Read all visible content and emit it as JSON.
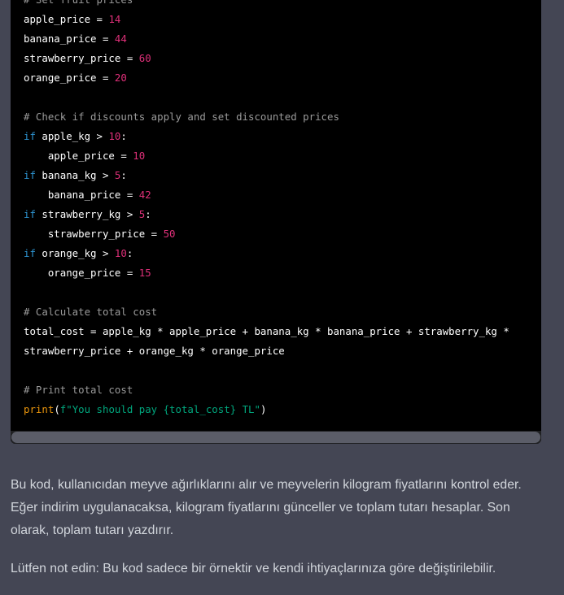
{
  "code": {
    "lines": [
      [
        {
          "t": "c",
          "v": "# Set fruit prices"
        }
      ],
      [
        {
          "t": "p",
          "v": "apple_price = "
        },
        {
          "t": "n",
          "v": "14"
        }
      ],
      [
        {
          "t": "p",
          "v": "banana_price = "
        },
        {
          "t": "n",
          "v": "44"
        }
      ],
      [
        {
          "t": "p",
          "v": "strawberry_price = "
        },
        {
          "t": "n",
          "v": "60"
        }
      ],
      [
        {
          "t": "p",
          "v": "orange_price = "
        },
        {
          "t": "n",
          "v": "20"
        }
      ],
      [],
      [
        {
          "t": "c",
          "v": "# Check if discounts apply and set discounted prices"
        }
      ],
      [
        {
          "t": "k",
          "v": "if"
        },
        {
          "t": "p",
          "v": " apple_kg > "
        },
        {
          "t": "n",
          "v": "10"
        },
        {
          "t": "p",
          "v": ":"
        }
      ],
      [
        {
          "t": "p",
          "v": "    apple_price = "
        },
        {
          "t": "n",
          "v": "10"
        }
      ],
      [
        {
          "t": "k",
          "v": "if"
        },
        {
          "t": "p",
          "v": " banana_kg > "
        },
        {
          "t": "n",
          "v": "5"
        },
        {
          "t": "p",
          "v": ":"
        }
      ],
      [
        {
          "t": "p",
          "v": "    banana_price = "
        },
        {
          "t": "n",
          "v": "42"
        }
      ],
      [
        {
          "t": "k",
          "v": "if"
        },
        {
          "t": "p",
          "v": " strawberry_kg > "
        },
        {
          "t": "n",
          "v": "5"
        },
        {
          "t": "p",
          "v": ":"
        }
      ],
      [
        {
          "t": "p",
          "v": "    strawberry_price = "
        },
        {
          "t": "n",
          "v": "50"
        }
      ],
      [
        {
          "t": "k",
          "v": "if"
        },
        {
          "t": "p",
          "v": " orange_kg > "
        },
        {
          "t": "n",
          "v": "10"
        },
        {
          "t": "p",
          "v": ":"
        }
      ],
      [
        {
          "t": "p",
          "v": "    orange_price = "
        },
        {
          "t": "n",
          "v": "15"
        }
      ],
      [],
      [
        {
          "t": "c",
          "v": "# Calculate total cost"
        }
      ],
      [
        {
          "t": "p",
          "v": "total_cost = apple_kg * apple_price + banana_kg * banana_price + strawberry_kg *"
        }
      ],
      [
        {
          "t": "p",
          "v": "strawberry_price + orange_kg * orange_price"
        }
      ],
      [],
      [
        {
          "t": "c",
          "v": "# Print total cost"
        }
      ],
      [
        {
          "t": "f",
          "v": "print"
        },
        {
          "t": "p",
          "v": "("
        },
        {
          "t": "s",
          "v": "f\"You should pay {total_cost} TL\""
        },
        {
          "t": "p",
          "v": ")"
        }
      ]
    ]
  },
  "response": {
    "paragraph1": "Bu kod, kullanıcıdan meyve ağırlıklarını alır ve meyvelerin kilogram fiyatlarını kontrol eder. Eğer indirim uygulanacaksa, kilogram fiyatlarını günceller ve toplam tutarı hesaplar. Son olarak, toplam tutarı yazdırır.",
    "paragraph2": "Lütfen not edin: Bu kod sadece bir örnektir ve kendi ihtiyaçlarınıza göre değiştirilebilir."
  },
  "colors": {
    "background": "#444654",
    "code_background": "#000000",
    "comment": "#9a9a9a",
    "keyword": "#2e95d3",
    "number": "#df3079",
    "string": "#00a67d",
    "builtin": "#e9950c"
  }
}
